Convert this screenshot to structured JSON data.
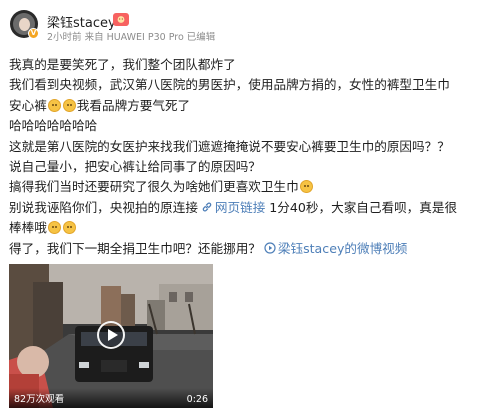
{
  "post": {
    "author": "梁钰stacey",
    "meta": "2小时前 来自 HUAWEI P30 Pro 已编辑",
    "text": {
      "l1": "我真的是要笑死了，我们整个团队都炸了",
      "l2": "我们看到央视频，武汉第八医院的男医护，使用品牌方捐的，女性的裤型卫生巾",
      "l3": "安心裤",
      "l3b": "我看品牌方要气死了",
      "l4": "哈哈哈哈哈哈哈",
      "l5": "这就是第八医院的女医护来找我们遮遮掩掩说不要安心裤要卫生巾的原因吗？？",
      "l6": "说自己量小，把安心裤让给同事了的原因吗？",
      "l7": "搞得我们当时还要研究了很久为啥她们更喜欢卫生巾",
      "l8a": "别说我诬陷你们，央视拍的原连接",
      "l8link": "网页链接",
      "l8b": " 1分40秒，大家自己看呗，真是很",
      "l9": "棒棒哦",
      "l10": "得了，我们下一期全捐卫生巾吧？还能挪用？",
      "l10link": "梁钰stacey的微博视频"
    },
    "video": {
      "views": "82万次观看",
      "duration": "0:26"
    }
  },
  "icons": {
    "avatar_badge": "vip-badge-icon",
    "level": "level-badge-icon",
    "emoji": "smile-emoji-icon",
    "link": "link-icon",
    "video_link": "video-link-icon",
    "play": "play-icon"
  },
  "colors": {
    "link": "#4e7fb8",
    "meta": "#8c8c8c",
    "text": "#1f1f1f"
  }
}
